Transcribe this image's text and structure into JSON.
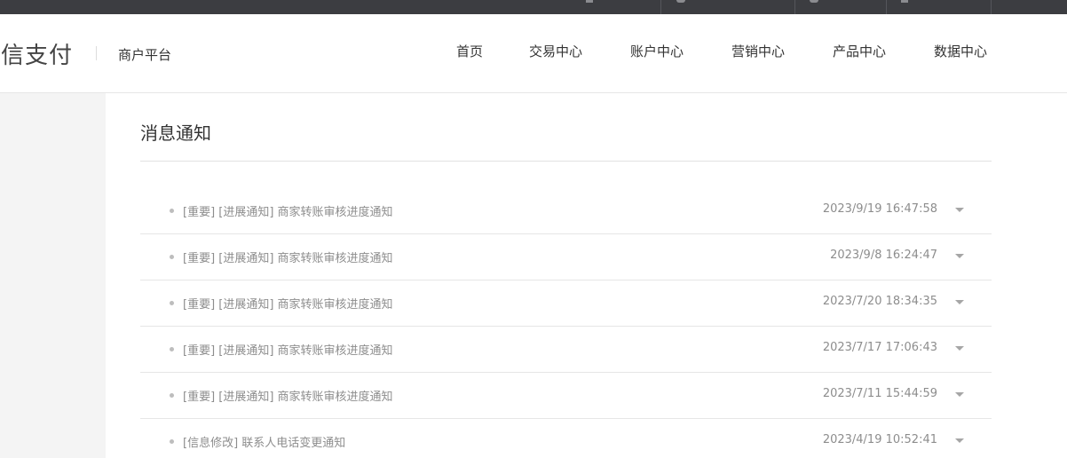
{
  "brand": {
    "logo_text": "微信支付",
    "subtitle": "商户平台"
  },
  "nav": [
    "首页",
    "交易中心",
    "账户中心",
    "营销中心",
    "产品中心",
    "数据中心"
  ],
  "topbar_icons": [
    "doc-icon",
    "user-icon",
    "help-icon",
    "file-icon"
  ],
  "page": {
    "title": "消息通知"
  },
  "messages": [
    {
      "text": "[重要] [进展通知] 商家转账审核进度通知",
      "time": "2023/9/19 16:47:58"
    },
    {
      "text": "[重要] [进展通知] 商家转账审核进度通知",
      "time": "2023/9/8 16:24:47"
    },
    {
      "text": "[重要] [进展通知] 商家转账审核进度通知",
      "time": "2023/7/20 18:34:35"
    },
    {
      "text": "[重要] [进展通知] 商家转账审核进度通知",
      "time": "2023/7/17 17:06:43"
    },
    {
      "text": "[重要] [进展通知] 商家转账审核进度通知",
      "time": "2023/7/11 15:44:59"
    },
    {
      "text": "[信息修改] 联系人电话变更通知",
      "time": "2023/4/19 10:52:41"
    }
  ],
  "colors": {
    "topbar": "#3c3d41",
    "sidebar": "#f4f4f4",
    "muted_text": "#8d8d8d"
  }
}
